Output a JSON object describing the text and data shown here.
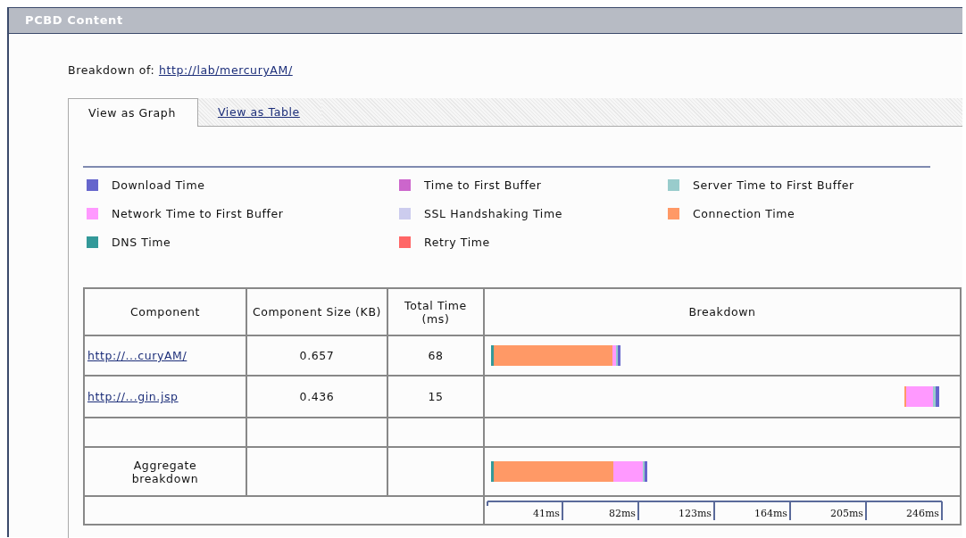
{
  "panel": {
    "title": "PCBD Content"
  },
  "breakdown_of": {
    "label": "Breakdown of:",
    "link": "http://lab/mercuryAM/"
  },
  "tabs": [
    {
      "label": "View as Graph",
      "selected": true
    },
    {
      "label": "View as Table",
      "selected": false
    }
  ],
  "legend": [
    {
      "label": "Download Time",
      "color": "#6666cc"
    },
    {
      "label": "Time to First Buffer",
      "color": "#cc66cc"
    },
    {
      "label": "Server Time to First Buffer",
      "color": "#99cccc"
    },
    {
      "label": "Network Time to First Buffer",
      "color": "#ff99ff"
    },
    {
      "label": "SSL Handshaking Time",
      "color": "#ccccee"
    },
    {
      "label": "Connection Time",
      "color": "#ff9966"
    },
    {
      "label": "DNS Time",
      "color": "#339999"
    },
    {
      "label": "Retry Time",
      "color": "#ff6666"
    }
  ],
  "table": {
    "columns": [
      "Component",
      "Component Size (KB)",
      "Total Time (ms)",
      "Breakdown"
    ],
    "rows": [
      {
        "kind": "link",
        "component": "http://...curyAM/",
        "size": "0.657",
        "time": "68"
      },
      {
        "kind": "link",
        "component": "http://...gin.jsp",
        "size": "0.436",
        "time": "15"
      },
      {
        "kind": "empty"
      },
      {
        "kind": "text",
        "component": "Aggregate breakdown"
      }
    ],
    "axis_labels": [
      "41ms",
      "82ms",
      "123ms",
      "164ms",
      "205ms",
      "246ms"
    ]
  }
}
